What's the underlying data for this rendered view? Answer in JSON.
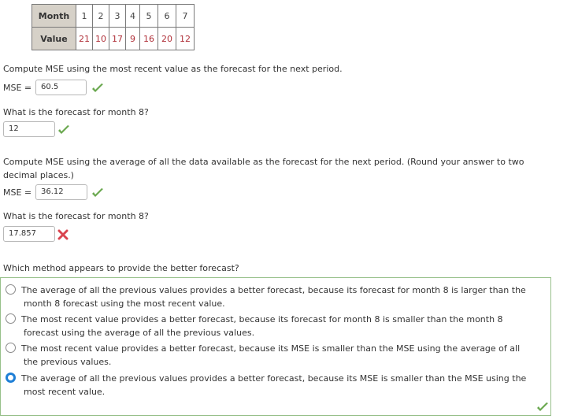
{
  "table": {
    "month_label": "Month",
    "value_label": "Value",
    "months": [
      "1",
      "2",
      "3",
      "4",
      "5",
      "6",
      "7"
    ],
    "values": [
      "21",
      "10",
      "17",
      "9",
      "16",
      "20",
      "12"
    ]
  },
  "q1": {
    "prompt": "Compute MSE using the most recent value as the forecast for the next period.",
    "mse_label": "MSE =",
    "mse_value": "60.5",
    "mse_status": "correct",
    "forecast_prompt": "What is the forecast for month 8?",
    "forecast_value": "12",
    "forecast_status": "correct"
  },
  "q2": {
    "prompt_line1": "Compute MSE using the average of all the data available as the forecast for the next period. (Round your answer to two",
    "prompt_line2": "decimal places.)",
    "mse_label": "MSE =",
    "mse_value": "36.12",
    "mse_status": "correct",
    "forecast_prompt": "What is the forecast for month 8?",
    "forecast_value": "17.857",
    "forecast_status": "incorrect"
  },
  "q3": {
    "prompt": "Which method appears to provide the better forecast?",
    "options": [
      {
        "line1": "The average of all the previous values provides a better forecast, because its forecast for month 8 is larger than the",
        "line2": "month 8 forecast using the most recent value.",
        "selected": false
      },
      {
        "line1": "The most recent value provides a better forecast, because its forecast for month 8 is smaller than the month 8",
        "line2": "forecast using the average of all the previous values.",
        "selected": false
      },
      {
        "line1": "The most recent value provides a better forecast, because its MSE is smaller than the MSE using the average of all",
        "line2": "the previous values.",
        "selected": false
      },
      {
        "line1": "The average of all the previous values provides a better forecast, because its MSE is smaller than the MSE using the",
        "line2": "most recent value.",
        "selected": true
      }
    ],
    "status": "correct"
  },
  "colors": {
    "correct": "#6aa84f",
    "incorrect": "#d9434e",
    "selected_radio": "#1e7fd6",
    "table_value": "#b0313a",
    "table_header_bg": "#d6d1c8",
    "answer_box_border": "#97c08a"
  }
}
